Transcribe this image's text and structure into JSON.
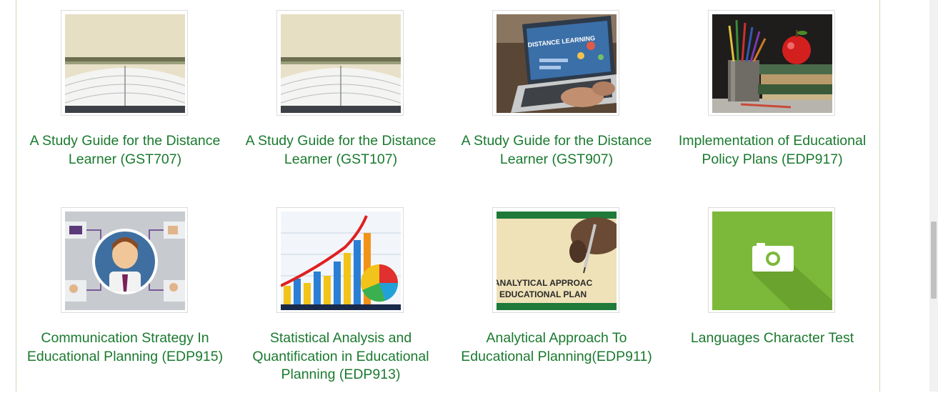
{
  "courses": [
    {
      "title": "A Study Guide for the Distance Learner (GST707)",
      "image": "open-book-thumbnail"
    },
    {
      "title": "A Study Guide for the Distance Learner (GST107)",
      "image": "open-book-thumbnail"
    },
    {
      "title": "A Study Guide for the Distance Learner (GST907)",
      "image": "laptop-distance-learning-thumbnail",
      "image_text": "DISTANCE LEARNING"
    },
    {
      "title": "Implementation of Educational Policy Plans (EDP917)",
      "image": "books-apple-pencils-thumbnail"
    },
    {
      "title": "Communication Strategy In Educational Planning (EDP915)",
      "image": "communication-people-thumbnail"
    },
    {
      "title": "Statistical Analysis and Quantification in Educational Planning (EDP913)",
      "image": "bar-chart-pie-thumbnail"
    },
    {
      "title": "Analytical Approach To Educational Planning(EDP911)",
      "image": "analytical-approach-thumbnail",
      "image_text_1": "ANALYTICAL APPROAC",
      "image_text_2": "EDUCATIONAL PLAN"
    },
    {
      "title": "Languages Character Test",
      "image": "camera-placeholder-icon"
    }
  ],
  "colors": {
    "title": "#1a7a2f",
    "placeholder_bg": "#7cb83a",
    "border": "#c9dcb8"
  }
}
